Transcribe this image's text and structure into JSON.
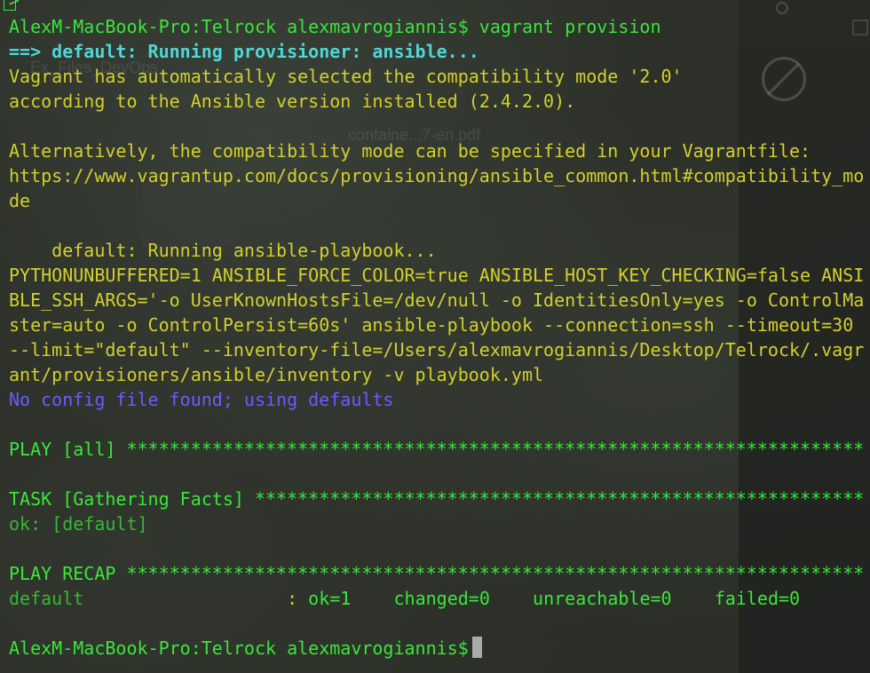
{
  "terminal": {
    "line0": ">",
    "prompt1": "AlexM-MacBook-Pro:Telrock alexmavrogiannis$ vagrant provision",
    "running_provisioner": "==> default: Running provisioner: ansible...",
    "compat1": "Vagrant has automatically selected the compatibility mode '2.0'",
    "compat2": "according to the Ansible version installed (2.4.2.0).",
    "alt1": "Alternatively, the compatibility mode can be specified in your Vagrantfile:",
    "alt2": "https://www.vagrantup.com/docs/provisioning/ansible_common.html#compatibility_mo",
    "alt3": "de",
    "running_playbook": "    default: Running ansible-playbook...",
    "cmd1": "PYTHONUNBUFFERED=1 ANSIBLE_FORCE_COLOR=true ANSIBLE_HOST_KEY_CHECKING=false ANSI",
    "cmd2": "BLE_SSH_ARGS='-o UserKnownHostsFile=/dev/null -o IdentitiesOnly=yes -o ControlMa",
    "cmd3": "ster=auto -o ControlPersist=60s' ansible-playbook --connection=ssh --timeout=30",
    "cmd4": "--limit=\"default\" --inventory-file=/Users/alexmavrogiannis/Desktop/Telrock/.vagr",
    "cmd5": "ant/provisioners/ansible/inventory -v playbook.yml",
    "no_config": "No config file found; using defaults",
    "play_all": "PLAY [all] *********************************************************************",
    "task_facts": "TASK [Gathering Facts] *********************************************************",
    "ok_default": "ok: [default]",
    "play_recap": "PLAY RECAP *********************************************************************",
    "recap_host": "default",
    "recap_sep": "                   : ",
    "recap_ok": "ok=1",
    "recap_changed": "    changed=0",
    "recap_unreachable": "    unreachable=0",
    "recap_failed": "    failed=0",
    "prompt2": "AlexM-MacBook-Pro:Telrock alexmavrogiannis$"
  },
  "background": {
    "ghost1": "Ex_Files_DevOps",
    "ghost2": "containe...7-en.pdf"
  },
  "colors": {
    "green": "#3ae63a",
    "yellow": "#d4cf2c",
    "cyan": "#4fd6d6",
    "blue": "#6b5cff"
  }
}
